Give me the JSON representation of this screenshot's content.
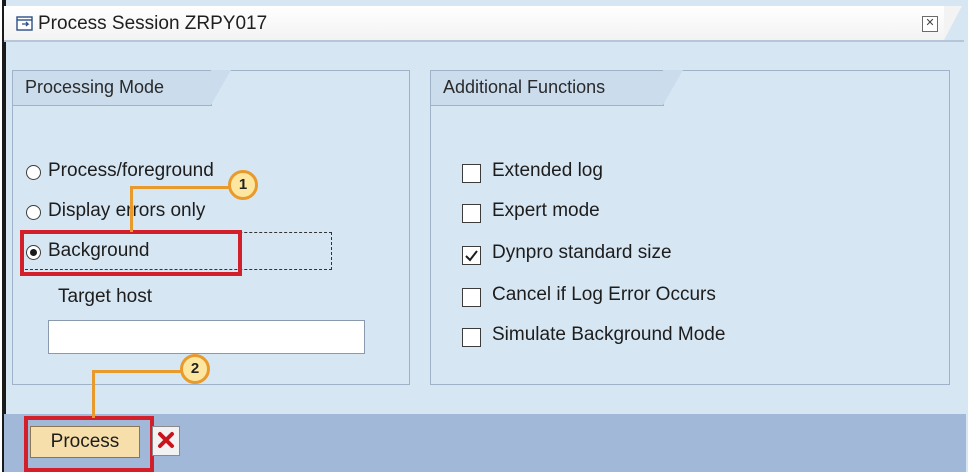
{
  "dialog": {
    "title": "Process Session ZRPY017",
    "close_icon": "close-icon"
  },
  "processing_mode": {
    "title": "Processing Mode",
    "options": [
      {
        "label": "Process/foreground",
        "selected": false
      },
      {
        "label": "Display errors only",
        "selected": false
      },
      {
        "label": "Background",
        "selected": true
      }
    ],
    "target_host_label": "Target host",
    "target_host_value": ""
  },
  "additional_functions": {
    "title": "Additional Functions",
    "options": [
      {
        "label": "Extended log",
        "checked": false
      },
      {
        "label": "Expert mode",
        "checked": false
      },
      {
        "label": "Dynpro standard size",
        "checked": true
      },
      {
        "label": "Cancel if Log Error Occurs",
        "checked": false
      },
      {
        "label": "Simulate Background Mode",
        "checked": false
      }
    ]
  },
  "toolbar": {
    "process_label": "Process",
    "cancel_icon": "red-x-icon"
  },
  "callouts": {
    "step1": "1",
    "step2": "2"
  },
  "colors": {
    "highlight_red": "#d21f2a",
    "callout_orange": "#e89a2c",
    "panel_blue": "#d6e6f3"
  }
}
